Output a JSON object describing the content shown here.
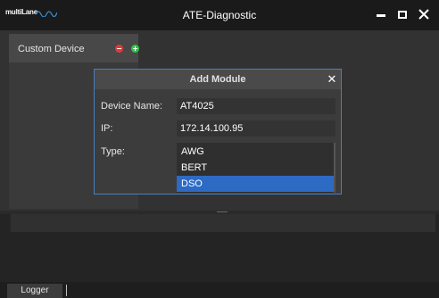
{
  "window": {
    "logo_text": "multiLane",
    "title": "ATE-Diagnostic",
    "minimize_icon": "minimize-icon",
    "maximize_icon": "maximize-icon",
    "close_icon": "close-icon"
  },
  "device_panel": {
    "label": "Custom Device",
    "remove_icon": "remove-circle-icon",
    "add_icon": "add-circle-icon"
  },
  "dialog": {
    "title": "Add Module",
    "close_glyph": "✕",
    "device_name_label": "Device Name:",
    "device_name_value": "AT4025",
    "ip_label": "IP:",
    "ip_value": "172.14.100.95",
    "type_label": "Type:",
    "type_options": [
      "AWG",
      "BERT",
      "DSO"
    ],
    "type_selected": "DSO"
  },
  "statusbar": {
    "logger_tab": "Logger"
  },
  "colors": {
    "selection": "#2d6ac4",
    "dialog_border": "#4a7fbf",
    "remove": "#e03a3a",
    "add": "#33c24a"
  }
}
